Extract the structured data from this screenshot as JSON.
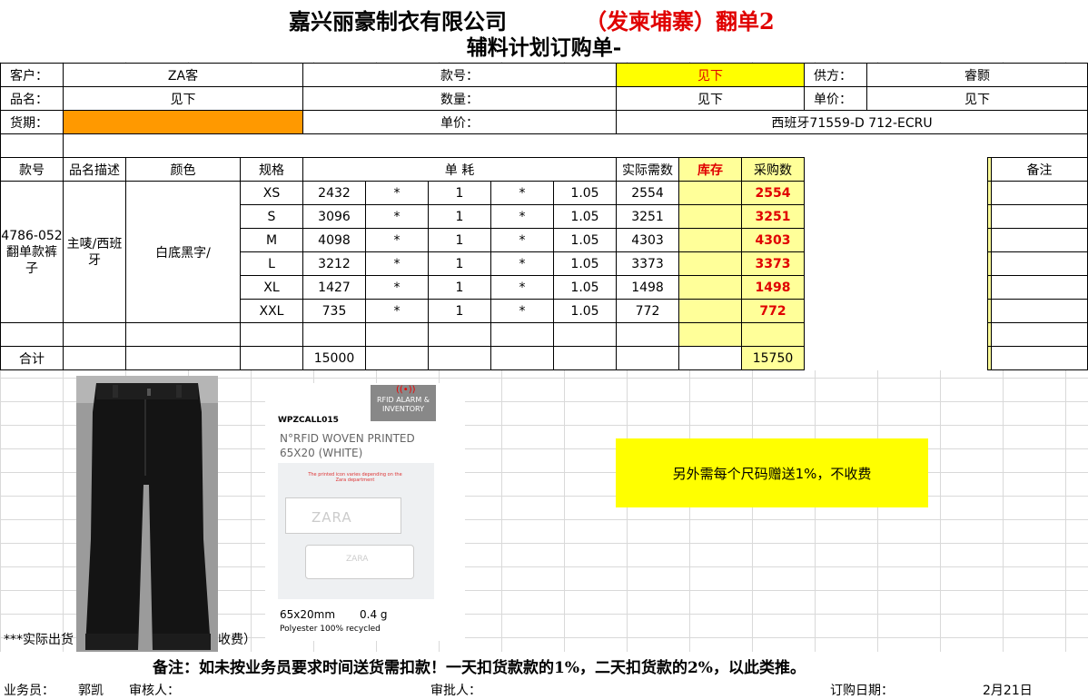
{
  "header": {
    "company": "嘉兴丽豪制衣有限公司",
    "title_red": "（发柬埔寨）翻单2",
    "form_title": "辅料计划订购单-"
  },
  "info": {
    "customer_label": "客户：",
    "customer_value": "ZA客",
    "style_label": "款号：",
    "style_value": "见下",
    "supplier_label": "供方：",
    "supplier_value": "睿颢",
    "product_label": "品名：",
    "product_value": "见下",
    "qty_label": "数量：",
    "qty_value": "见下",
    "unit_price_label": "单价：",
    "unit_price_value": "见下",
    "delivery_label": "货期：",
    "delivery_value": "",
    "price_label": "单价：",
    "price_value": "西班牙71559-D 712-ECRU"
  },
  "table": {
    "headers": {
      "style": "款号",
      "desc": "品名描述",
      "color": "颜色",
      "size": "规格",
      "consumption": "单 耗",
      "actual": "实际需数",
      "stock": "库存",
      "purchase": "采购数",
      "remark": "备注"
    },
    "style_no": "4786-052翻单款裤子",
    "product_desc": "主唛/西班牙",
    "color": "白底黑字/",
    "rows": [
      {
        "size": "XS",
        "qty": "2432",
        "op1": "*",
        "unit": "1",
        "op2": "*",
        "factor": "1.05",
        "actual": "2554",
        "purchase": "2554"
      },
      {
        "size": "S",
        "qty": "3096",
        "op1": "*",
        "unit": "1",
        "op2": "*",
        "factor": "1.05",
        "actual": "3251",
        "purchase": "3251"
      },
      {
        "size": "M",
        "qty": "4098",
        "op1": "*",
        "unit": "1",
        "op2": "*",
        "factor": "1.05",
        "actual": "4303",
        "purchase": "4303"
      },
      {
        "size": "L",
        "qty": "3212",
        "op1": "*",
        "unit": "1",
        "op2": "*",
        "factor": "1.05",
        "actual": "3373",
        "purchase": "3373"
      },
      {
        "size": "XL",
        "qty": "1427",
        "op1": "*",
        "unit": "1",
        "op2": "*",
        "factor": "1.05",
        "actual": "1498",
        "purchase": "1498"
      },
      {
        "size": "XXL",
        "qty": "735",
        "op1": "*",
        "unit": "1",
        "op2": "*",
        "factor": "1.05",
        "actual": "772",
        "purchase": "772"
      }
    ],
    "total_label": "合计",
    "total_qty": "15000",
    "total_purchase": "15750"
  },
  "label_image": {
    "badge": "RFID ALARM & INVENTORY",
    "code": "WPZCALL015",
    "name_line1": "N°RFID WOVEN PRINTED",
    "name_line2": "65X20 (WHITE)",
    "note": "The printed icon varies depending on the Zara department",
    "brand": "ZARA",
    "size": "65x20mm",
    "weight": "0.4 g",
    "material": "Polyester 100% recycled"
  },
  "notes": {
    "yellow_note": "另外需每个尺码赠送1%，不收费",
    "partial_left": "***实际出货",
    "partial_right": "收费）",
    "penalty": "备注：如未按业务员要求时间送货需扣款！一天扣货款款的1%，二天扣货款的2%，以此类推。"
  },
  "footer": {
    "salesman_label": "业务员：",
    "salesman": "郭凯",
    "reviewer_label": "审核人：",
    "approver_label": "审批人：",
    "order_date_label": "订购日期：",
    "order_date": "2月21日"
  },
  "colors": {
    "yellow": "#ffff00",
    "light_yellow": "#ffff99",
    "orange": "#ff9900",
    "red": "#e00000"
  }
}
